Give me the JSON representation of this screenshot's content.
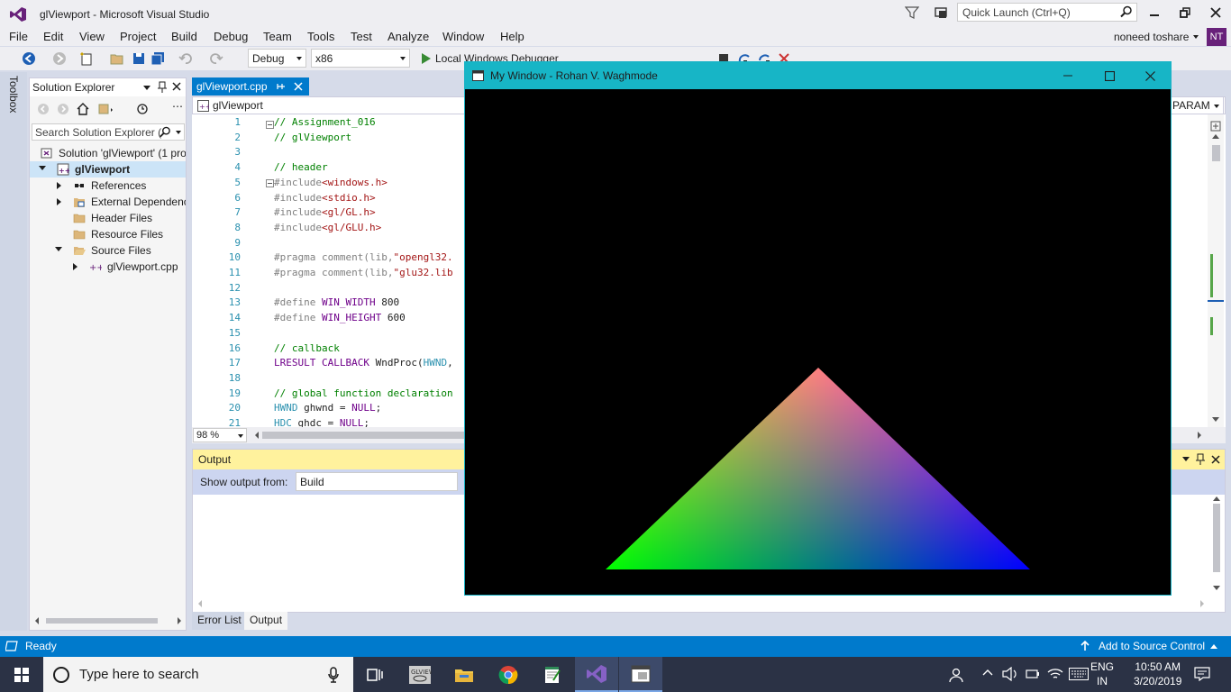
{
  "vs": {
    "window_title": "glViewport - Microsoft Visual Studio",
    "quick_launch_placeholder": "Quick Launch (Ctrl+Q)",
    "menu": [
      "File",
      "Edit",
      "View",
      "Project",
      "Build",
      "Debug",
      "Team",
      "Tools",
      "Test",
      "Analyze",
      "Window",
      "Help"
    ],
    "user": {
      "name": "noneed toshare",
      "initials": "NT"
    },
    "toolbar": {
      "config": "Debug",
      "platform": "x86",
      "debugger_label": "Local Windows Debugger"
    }
  },
  "toolbox": {
    "label": "Toolbox"
  },
  "solution_explorer": {
    "title": "Solution Explorer",
    "search_placeholder": "Search Solution Explorer (",
    "items": [
      {
        "label": "Solution 'glViewport' (1 pro",
        "icon": "solution-icon",
        "indent": 0,
        "arrow": "none"
      },
      {
        "label": "glViewport",
        "icon": "cpp-project-icon",
        "indent": 1,
        "arrow": "down",
        "bold": true
      },
      {
        "label": "References",
        "icon": "references-icon",
        "indent": 2,
        "arrow": "right"
      },
      {
        "label": "External Dependenci",
        "icon": "external-deps-icon",
        "indent": 2,
        "arrow": "right"
      },
      {
        "label": "Header Files",
        "icon": "folder-icon",
        "indent": 2,
        "arrow": "none"
      },
      {
        "label": "Resource Files",
        "icon": "folder-icon",
        "indent": 2,
        "arrow": "none"
      },
      {
        "label": "Source Files",
        "icon": "folder-open-icon",
        "indent": 2,
        "arrow": "down"
      },
      {
        "label": "glViewport.cpp",
        "icon": "cpp-file-icon",
        "indent": 3,
        "arrow": "right"
      }
    ]
  },
  "editor": {
    "tab_label": "glViewport.cpp",
    "nav_scope": "glViewport",
    "nav_right": "PARAM",
    "zoom": "98 %",
    "lines": [
      {
        "n": "1",
        "html": "<span class=\"cm\">// Assignment_016</span>"
      },
      {
        "n": "2",
        "html": "<span class=\"cm\">// glViewport</span>"
      },
      {
        "n": "3",
        "html": ""
      },
      {
        "n": "4",
        "html": "<span class=\"cm\">// header</span>"
      },
      {
        "n": "5",
        "html": "<span class=\"pp\">#include</span><span class=\"str\">&lt;windows.h&gt;</span>"
      },
      {
        "n": "6",
        "html": "<span class=\"pp\">#include</span><span class=\"str\">&lt;stdio.h&gt;</span>"
      },
      {
        "n": "7",
        "html": "<span class=\"pp\">#include</span><span class=\"str\">&lt;gl/GL.h&gt;</span>"
      },
      {
        "n": "8",
        "html": "<span class=\"pp\">#include</span><span class=\"str\">&lt;gl/GLU.h&gt;</span>"
      },
      {
        "n": "9",
        "html": ""
      },
      {
        "n": "10",
        "html": "<span class=\"pp\">#pragma comment(lib,</span><span class=\"str\">\"opengl32.</span>"
      },
      {
        "n": "11",
        "html": "<span class=\"pp\">#pragma comment(lib,</span><span class=\"str\">\"glu32.lib</span>"
      },
      {
        "n": "12",
        "html": ""
      },
      {
        "n": "13",
        "html": "<span class=\"pp\">#define </span><span class=\"mac\">WIN_WIDTH</span> 800"
      },
      {
        "n": "14",
        "html": "<span class=\"pp\">#define </span><span class=\"mac\">WIN_HEIGHT</span> 600"
      },
      {
        "n": "15",
        "html": ""
      },
      {
        "n": "16",
        "html": "<span class=\"cm\">// callback</span>"
      },
      {
        "n": "17",
        "html": "<span class=\"mac\">LRESULT CALLBACK</span> WndProc(<span class=\"typ\">HWND</span>,"
      },
      {
        "n": "18",
        "html": ""
      },
      {
        "n": "19",
        "html": "<span class=\"cm\">// global function declaration</span>"
      },
      {
        "n": "20",
        "html": "<span class=\"typ\">HWND</span> ghwnd = <span class=\"mac\">NULL</span>;"
      },
      {
        "n": "21",
        "html": "<span class=\"typ\">HDC</span> ghdc = <span class=\"mac\">NULL</span>;"
      }
    ]
  },
  "output": {
    "title": "Output",
    "show_from_label": "Show output from:",
    "source": "Build"
  },
  "bottom_tabs": [
    "Error List",
    "Output"
  ],
  "status": {
    "left": "Ready",
    "right": "Add to Source Control"
  },
  "glwindow": {
    "title": "My Window - Rohan V. Waghmode",
    "triangle": {
      "top_color": "#ff0000",
      "left_color": "#00ff00",
      "right_color": "#0000ff"
    }
  },
  "taskbar": {
    "search_placeholder": "Type here to search",
    "apps": [
      "task-view-icon",
      "glview-app-icon",
      "file-explorer-icon",
      "chrome-icon",
      "notepad-icon",
      "visual-studio-icon",
      "opengl-window-icon"
    ],
    "lang": [
      "ENG",
      "IN"
    ],
    "time": "10:50 AM",
    "date": "3/20/2019"
  }
}
